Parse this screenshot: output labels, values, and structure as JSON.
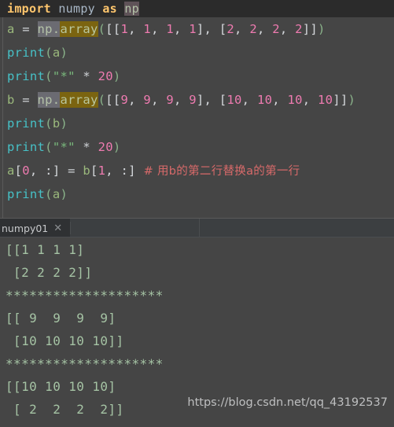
{
  "editor": {
    "lines": [
      {
        "id": "line-import",
        "current": true,
        "tokens": [
          {
            "cls": "t-kw",
            "text": "import"
          },
          {
            "cls": "t-plain",
            "text": " numpy "
          },
          {
            "cls": "t-kw",
            "text": "as"
          },
          {
            "cls": "t-plain",
            "text": " "
          },
          {
            "cls": "hl-np-dark",
            "text": "np"
          }
        ]
      },
      {
        "id": "line-a-assign",
        "current": false,
        "tokens": [
          {
            "cls": "t-var",
            "text": "a "
          },
          {
            "cls": "t-op",
            "text": "= "
          },
          {
            "cls": "hl-np",
            "text": "np."
          },
          {
            "cls": "hl-array",
            "text": "array"
          },
          {
            "cls": "t-paren",
            "text": "("
          },
          {
            "cls": "t-bracket",
            "text": "[["
          },
          {
            "cls": "t-num",
            "text": "1"
          },
          {
            "cls": "t-bracket",
            "text": ", "
          },
          {
            "cls": "t-num",
            "text": "1"
          },
          {
            "cls": "t-bracket",
            "text": ", "
          },
          {
            "cls": "t-num",
            "text": "1"
          },
          {
            "cls": "t-bracket",
            "text": ", "
          },
          {
            "cls": "t-num",
            "text": "1"
          },
          {
            "cls": "t-bracket",
            "text": "], ["
          },
          {
            "cls": "t-num",
            "text": "2"
          },
          {
            "cls": "t-bracket",
            "text": ", "
          },
          {
            "cls": "t-num",
            "text": "2"
          },
          {
            "cls": "t-bracket",
            "text": ", "
          },
          {
            "cls": "t-num",
            "text": "2"
          },
          {
            "cls": "t-bracket",
            "text": ", "
          },
          {
            "cls": "t-num",
            "text": "2"
          },
          {
            "cls": "t-bracket",
            "text": "]]"
          },
          {
            "cls": "t-paren",
            "text": ")"
          }
        ]
      },
      {
        "id": "line-print-a-1",
        "current": false,
        "tokens": [
          {
            "cls": "t-fn",
            "text": "print"
          },
          {
            "cls": "t-paren",
            "text": "("
          },
          {
            "cls": "t-var",
            "text": "a"
          },
          {
            "cls": "t-paren",
            "text": ")"
          }
        ]
      },
      {
        "id": "line-print-stars-1",
        "current": false,
        "tokens": [
          {
            "cls": "t-fn",
            "text": "print"
          },
          {
            "cls": "t-paren",
            "text": "("
          },
          {
            "cls": "t-str",
            "text": "\"*\""
          },
          {
            "cls": "t-op",
            "text": " * "
          },
          {
            "cls": "t-num",
            "text": "20"
          },
          {
            "cls": "t-paren",
            "text": ")"
          }
        ]
      },
      {
        "id": "line-b-assign",
        "current": false,
        "tokens": [
          {
            "cls": "t-var",
            "text": "b "
          },
          {
            "cls": "t-op",
            "text": "= "
          },
          {
            "cls": "hl-np",
            "text": "np."
          },
          {
            "cls": "hl-array",
            "text": "array"
          },
          {
            "cls": "t-paren",
            "text": "("
          },
          {
            "cls": "t-bracket",
            "text": "[["
          },
          {
            "cls": "t-num",
            "text": "9"
          },
          {
            "cls": "t-bracket",
            "text": ", "
          },
          {
            "cls": "t-num",
            "text": "9"
          },
          {
            "cls": "t-bracket",
            "text": ", "
          },
          {
            "cls": "t-num",
            "text": "9"
          },
          {
            "cls": "t-bracket",
            "text": ", "
          },
          {
            "cls": "t-num",
            "text": "9"
          },
          {
            "cls": "t-bracket",
            "text": "], ["
          },
          {
            "cls": "t-num",
            "text": "10"
          },
          {
            "cls": "t-bracket",
            "text": ", "
          },
          {
            "cls": "t-num",
            "text": "10"
          },
          {
            "cls": "t-bracket",
            "text": ", "
          },
          {
            "cls": "t-num",
            "text": "10"
          },
          {
            "cls": "t-bracket",
            "text": ", "
          },
          {
            "cls": "t-num",
            "text": "10"
          },
          {
            "cls": "t-bracket",
            "text": "]]"
          },
          {
            "cls": "t-paren",
            "text": ")"
          }
        ]
      },
      {
        "id": "line-print-b",
        "current": false,
        "tokens": [
          {
            "cls": "t-fn",
            "text": "print"
          },
          {
            "cls": "t-paren",
            "text": "("
          },
          {
            "cls": "t-var",
            "text": "b"
          },
          {
            "cls": "t-paren",
            "text": ")"
          }
        ]
      },
      {
        "id": "line-print-stars-2",
        "current": false,
        "tokens": [
          {
            "cls": "t-fn",
            "text": "print"
          },
          {
            "cls": "t-paren",
            "text": "("
          },
          {
            "cls": "t-str",
            "text": "\"*\""
          },
          {
            "cls": "t-op",
            "text": " * "
          },
          {
            "cls": "t-num",
            "text": "20"
          },
          {
            "cls": "t-paren",
            "text": ")"
          }
        ]
      },
      {
        "id": "line-slice-assign",
        "current": false,
        "tokens": [
          {
            "cls": "t-var",
            "text": "a"
          },
          {
            "cls": "t-bracket",
            "text": "["
          },
          {
            "cls": "t-num",
            "text": "0"
          },
          {
            "cls": "t-bracket",
            "text": ", :]"
          },
          {
            "cls": "t-op",
            "text": " = "
          },
          {
            "cls": "t-var",
            "text": "b"
          },
          {
            "cls": "t-bracket",
            "text": "["
          },
          {
            "cls": "t-num",
            "text": "1"
          },
          {
            "cls": "t-bracket",
            "text": ", :]"
          },
          {
            "cls": "t-comment",
            "text": "  # 用b的第二行替换a的第一行"
          }
        ]
      },
      {
        "id": "line-print-a-2",
        "current": false,
        "tokens": [
          {
            "cls": "t-fn",
            "text": "print"
          },
          {
            "cls": "t-paren",
            "text": "("
          },
          {
            "cls": "t-var",
            "text": "a"
          },
          {
            "cls": "t-paren",
            "text": ")"
          }
        ]
      }
    ]
  },
  "run_panel": {
    "tab": {
      "label": "numpy01",
      "close_glyph": "✕"
    },
    "output_lines": [
      "[[1 1 1 1]",
      " [2 2 2 2]]",
      "********************",
      "[[ 9  9  9  9]",
      " [10 10 10 10]]",
      "********************",
      "[[10 10 10 10]",
      " [ 2  2  2  2]]"
    ]
  },
  "watermark": {
    "text": "https://blog.csdn.net/qq_43192537"
  }
}
